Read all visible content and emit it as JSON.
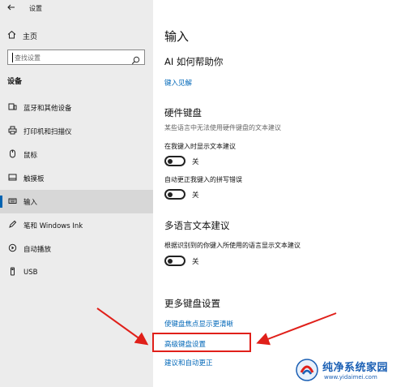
{
  "window": {
    "title": "设置"
  },
  "sidebar": {
    "home_label": "主页",
    "search_placeholder": "查找设置",
    "section_label": "设备",
    "items": [
      {
        "label": "蓝牙和其他设备",
        "icon": "bluetooth-devices-icon",
        "active": false
      },
      {
        "label": "打印机和扫描仪",
        "icon": "printer-icon",
        "active": false
      },
      {
        "label": "鼠标",
        "icon": "mouse-icon",
        "active": false
      },
      {
        "label": "触摸板",
        "icon": "touchpad-icon",
        "active": false
      },
      {
        "label": "输入",
        "icon": "keyboard-icon",
        "active": true
      },
      {
        "label": "笔和 Windows Ink",
        "icon": "pen-icon",
        "active": false
      },
      {
        "label": "自动播放",
        "icon": "autoplay-icon",
        "active": false
      },
      {
        "label": "USB",
        "icon": "usb-icon",
        "active": false
      }
    ]
  },
  "main": {
    "title": "输入",
    "ai_help": {
      "heading": "AI 如何帮助你",
      "link": "键入见解"
    },
    "hardware_keyboard": {
      "heading": "硬件键盘",
      "description": "某些语言中无法使用硬件键盘的文本建议",
      "settings": [
        {
          "label": "在我键入时显示文本建议",
          "state": "关",
          "on": false
        },
        {
          "label": "自动更正我键入的拼写错误",
          "state": "关",
          "on": false
        }
      ]
    },
    "multilingual": {
      "heading": "多语言文本建议",
      "settings": [
        {
          "label": "根据识别到的你键入所使用的语言显示文本建议",
          "state": "关",
          "on": false
        }
      ]
    },
    "more_keyboard": {
      "heading": "更多键盘设置",
      "links": [
        "使键盘焦点显示更清晰",
        "高级键盘设置",
        "建议和自动更正"
      ]
    }
  },
  "annotation": {
    "highlight_color": "#e0201a",
    "arrow_color": "#e0201a"
  },
  "accent_color": "#0067b8",
  "watermark": {
    "text": "纯净系统家园",
    "url": "www.yidaimei.com"
  }
}
